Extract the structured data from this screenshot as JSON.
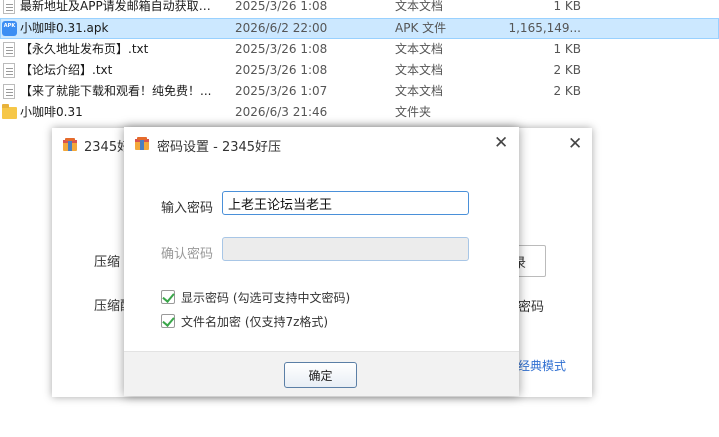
{
  "files": [
    {
      "name": "最新地址及APP请发邮箱自动获取！...",
      "date": "2025/3/26 1:08",
      "type": "文本文档",
      "size": "1 KB",
      "icon": "text-file-icon"
    },
    {
      "name": "小咖啡0.31.apk",
      "date": "2026/6/2 22:00",
      "type": "APK 文件",
      "size": "1,165,149...",
      "icon": "apk-file-icon",
      "selected": true
    },
    {
      "name": "【永久地址发布页】.txt",
      "date": "2025/3/26 1:08",
      "type": "文本文档",
      "size": "1 KB",
      "icon": "text-file-icon"
    },
    {
      "name": "【论坛介绍】.txt",
      "date": "2025/3/26 1:08",
      "type": "文本文档",
      "size": "2 KB",
      "icon": "text-file-icon"
    },
    {
      "name": "【来了就能下载和观看！纯免费！...",
      "date": "2025/3/26 1:07",
      "type": "文本文档",
      "size": "2 KB",
      "icon": "text-file-icon"
    },
    {
      "name": "小咖啡0.31",
      "date": "2026/6/3 21:46",
      "type": "文件夹",
      "size": "",
      "icon": "folder-icon"
    }
  ],
  "back_window": {
    "title": "2345好",
    "label_compress": "压缩",
    "label_compress2": "压缩配",
    "button_partial": "录",
    "label_right": "密码",
    "link_classic": "经典模式"
  },
  "dialog": {
    "title": "密码设置 - 2345好压",
    "password_label": "输入密码",
    "password_value": "上老王论坛当老王",
    "confirm_label": "确认密码",
    "confirm_value": "",
    "show_password_label": "显示密码 (勾选可支持中文密码)",
    "show_password_checked": true,
    "encrypt_names_label": "文件名加密 (仅支持7z格式)",
    "encrypt_names_checked": true,
    "ok_label": "确定"
  },
  "colors": {
    "selection": "#cce8ff",
    "accent": "#4a90d9",
    "check": "#3aa64a",
    "link": "#2f6fd1"
  }
}
